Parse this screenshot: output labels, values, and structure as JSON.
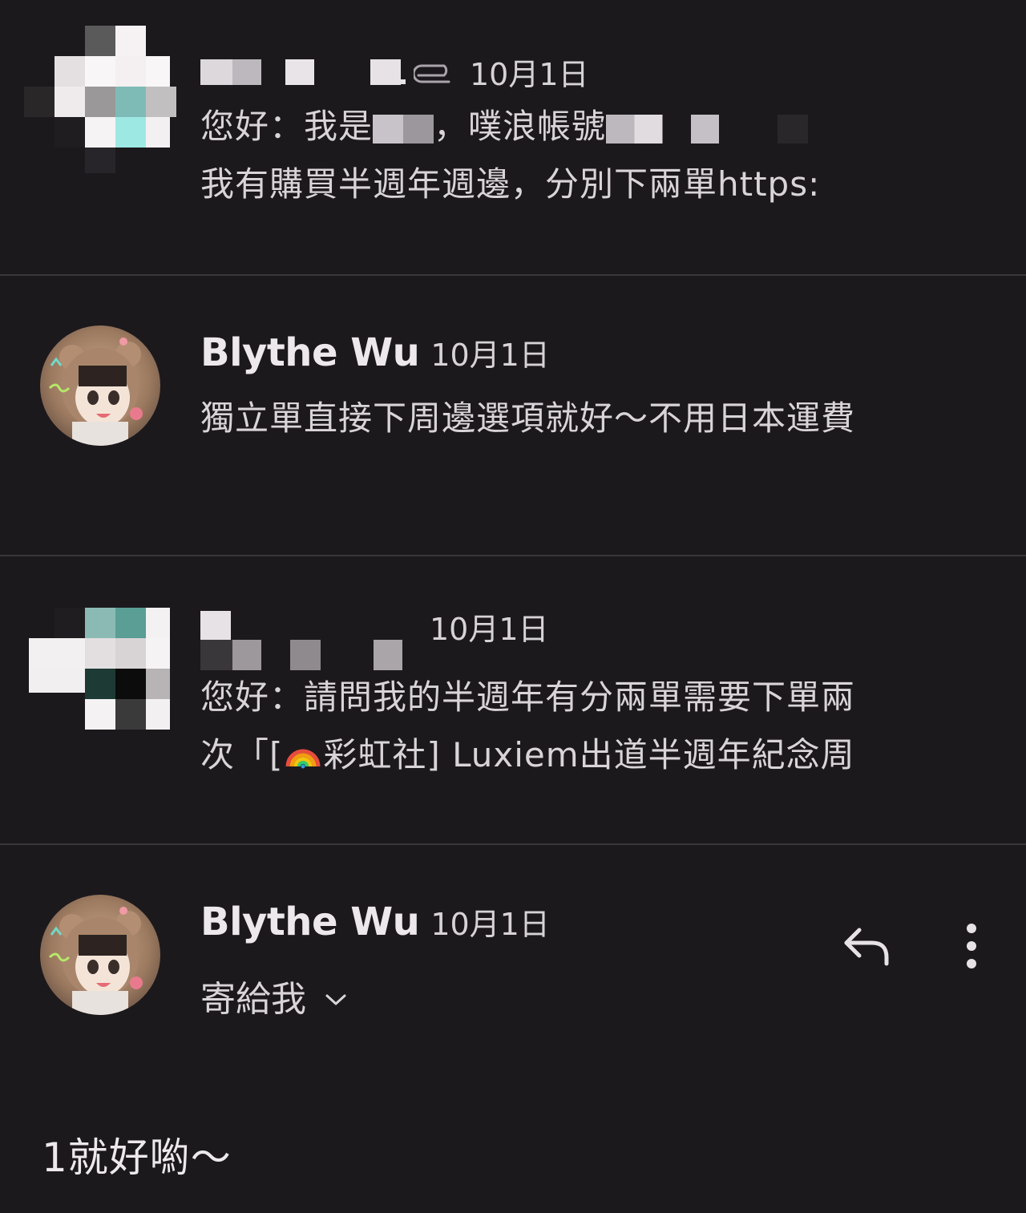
{
  "messages": [
    {
      "sender": "",
      "sender_redacted": true,
      "has_attachment": true,
      "attachment_icon": "paperclip-icon",
      "date": "10月1日",
      "snippet_parts": [
        "您好：我是",
        "，噗浪帳號"
      ],
      "snippet_line2": "我有購買半週年週邊，分別下兩單https:"
    },
    {
      "sender": "Blythe Wu",
      "date": "10月1日",
      "snippet": "獨立單直接下周邊選項就好～不用日本運費"
    },
    {
      "sender": "",
      "sender_redacted": true,
      "date": "10月1日",
      "snippet_line1": "您好：請問我的半週年有分兩單需要下單兩",
      "snippet_line2_prefix": "次「[",
      "snippet_line2_emoji": "rainbow-emoji",
      "snippet_line2_suffix": "彩虹社] Luxiem出道半週年紀念周"
    },
    {
      "sender": "Blythe Wu",
      "date": "10月1日",
      "recipient_label": "寄給我",
      "recipient_icon": "chevron-down-icon",
      "reply_icon": "reply-icon",
      "more_icon": "more-vert-icon",
      "body": "1就好喲～"
    }
  ],
  "colors": {
    "background": "#1c191d",
    "divider": "#3a373b",
    "text_primary": "#ece8ec",
    "text_secondary": "#d8d4d8"
  }
}
